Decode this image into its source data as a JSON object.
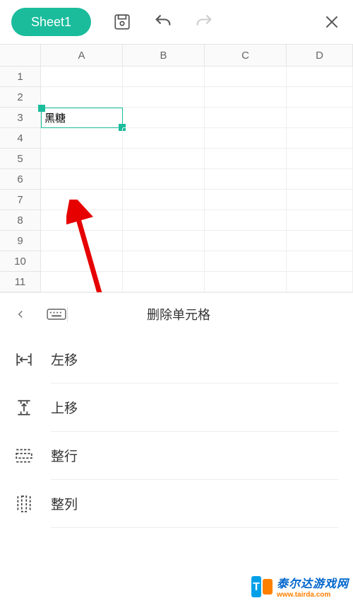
{
  "toolbar": {
    "sheet_label": "Sheet1"
  },
  "columns": [
    "A",
    "B",
    "C",
    "D"
  ],
  "rows": [
    "1",
    "2",
    "3",
    "4",
    "5",
    "6",
    "7",
    "8",
    "9",
    "10",
    "11"
  ],
  "selected_cell": {
    "row": 3,
    "col": "A",
    "value": "黑糖"
  },
  "panel": {
    "title": "删除单元格",
    "options": {
      "shift_left": "左移",
      "shift_up": "上移",
      "entire_row": "整行",
      "entire_col": "整列"
    }
  },
  "watermark": {
    "name": "泰尔达游戏网",
    "url": "www.tairda.com"
  }
}
